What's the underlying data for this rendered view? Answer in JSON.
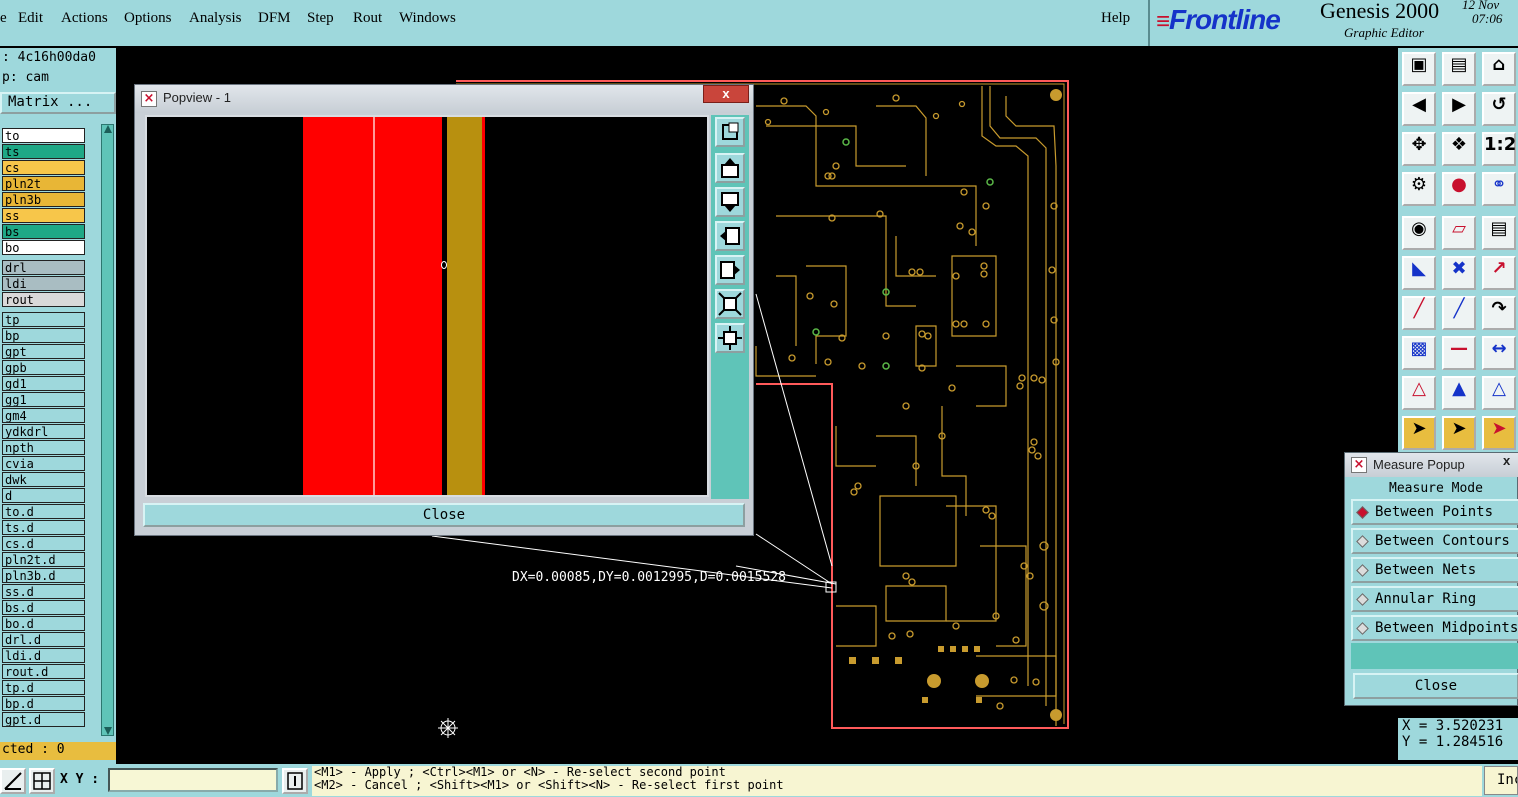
{
  "menu": {
    "items": [
      "e",
      "Edit",
      "Actions",
      "Options",
      "Analysis",
      "DFM",
      "Step",
      "Rout",
      "Windows"
    ],
    "help": "Help"
  },
  "brand": {
    "logo": "Frontline",
    "title": "Genesis 2000",
    "subtitle": "Graphic Editor",
    "date": "12 Nov",
    "time": "07:06"
  },
  "left_panel": {
    "job": ": 4c16h00da0",
    "step": "p: cam",
    "matrix_button": "Matrix ...",
    "selected": "cted : 0",
    "layers": [
      {
        "name": "to",
        "color": "#ffffff"
      },
      {
        "name": "ts",
        "color": "#1ea886"
      },
      {
        "name": "cs",
        "color": "#f7c64a"
      },
      {
        "name": "pln2t",
        "color": "#e8b636"
      },
      {
        "name": "pln3b",
        "color": "#e8b636"
      },
      {
        "name": "ss",
        "color": "#f7c64a"
      },
      {
        "name": "bs",
        "color": "#1ea886"
      },
      {
        "name": "bo",
        "color": "#ffffff"
      },
      {
        "name": "drl",
        "color": "#a9bdc2"
      },
      {
        "name": "ldi",
        "color": "#a9bdc2"
      },
      {
        "name": "rout",
        "color": "#d9d9d9"
      },
      {
        "name": "tp",
        "color": "#9ed8dc"
      },
      {
        "name": "bp",
        "color": "#9ed8dc"
      },
      {
        "name": "gpt",
        "color": "#9ed8dc"
      },
      {
        "name": "gpb",
        "color": "#9ed8dc"
      },
      {
        "name": "gd1",
        "color": "#9ed8dc"
      },
      {
        "name": "gg1",
        "color": "#9ed8dc"
      },
      {
        "name": "gm4",
        "color": "#9ed8dc"
      },
      {
        "name": "ydkdrl",
        "color": "#9ed8dc"
      },
      {
        "name": "npth",
        "color": "#9ed8dc"
      },
      {
        "name": "cvia",
        "color": "#9ed8dc"
      },
      {
        "name": "dwk",
        "color": "#9ed8dc"
      },
      {
        "name": "d",
        "color": "#9ed8dc"
      },
      {
        "name": "to.d",
        "color": "#9ed8dc"
      },
      {
        "name": "ts.d",
        "color": "#9ed8dc"
      },
      {
        "name": "cs.d",
        "color": "#9ed8dc"
      },
      {
        "name": "pln2t.d",
        "color": "#9ed8dc"
      },
      {
        "name": "pln3b.d",
        "color": "#9ed8dc"
      },
      {
        "name": "ss.d",
        "color": "#9ed8dc"
      },
      {
        "name": "bs.d",
        "color": "#9ed8dc"
      },
      {
        "name": "bo.d",
        "color": "#9ed8dc"
      },
      {
        "name": "drl.d",
        "color": "#9ed8dc"
      },
      {
        "name": "ldi.d",
        "color": "#9ed8dc"
      },
      {
        "name": "rout.d",
        "color": "#9ed8dc"
      },
      {
        "name": "tp.d",
        "color": "#9ed8dc"
      },
      {
        "name": "bp.d",
        "color": "#9ed8dc"
      },
      {
        "name": "gpt.d",
        "color": "#9ed8dc"
      }
    ]
  },
  "popview": {
    "title": "Popview - 1",
    "close_x": "x",
    "close_button": "Close",
    "side_icons": [
      "zoom-window-icon",
      "pan-up-icon",
      "pan-down-icon",
      "pan-left-icon",
      "pan-right-icon",
      "zoom-fit-icon",
      "zoom-center-icon"
    ]
  },
  "measure_readout": "DX=0.00085,DY=0.0012995,D=0.0015528",
  "measure_popup": {
    "title": "Measure Popup",
    "close_x": "x",
    "header": "Measure Mode",
    "options": [
      "Between Points",
      "Between Contours",
      "Between Nets",
      "Annular Ring",
      "Between Midpoints"
    ],
    "selected_option": "Between Points",
    "close_button": "Close"
  },
  "coords": {
    "x": "X = 3.520231",
    "y": "Y = 1.284516"
  },
  "status": {
    "xy_label": "X Y :",
    "xy_value": "",
    "hint_line1": "<M1> - Apply  ; <Ctrl><M1> or <N> - Re-select second point",
    "hint_line2": "<M2> - Cancel ; <Shift><M1> or <Shift><N> - Re-select first point",
    "ind_button": "Inc"
  },
  "right_tools": [
    "zoom-in-icon",
    "zoom-out-icon",
    "home-icon",
    "pan-left-icon",
    "pan-right-icon",
    "undo-zoom-icon",
    "fit-all-icon",
    "fit-profile-icon",
    "scale-1to2-icon",
    "snap-icon",
    "measure-icon",
    "netlist-icon",
    "add-feature-icon",
    "edit-shape-icon",
    "ruler-icon",
    "connect-nodes-icon",
    "delete-feature-icon",
    "move-node-icon",
    "draw-line-icon",
    "draw-line-red-icon",
    "draw-arc-icon",
    "select-node-icon",
    "cut-line-icon",
    "resize-icon",
    "triangle-icon",
    "triangle-arrow-icon",
    "arc-arrow-icon",
    "select-pointer-icon",
    "select-pointer-box-icon",
    "select-rotate-icon"
  ],
  "colors": {
    "panel": "#9ed8dc",
    "button_teal": "#5fc4b8",
    "trace": "#c89b2e",
    "popview_red": "#ff0000",
    "popview_gold": "#b8900f",
    "profile": "#ff6060"
  }
}
